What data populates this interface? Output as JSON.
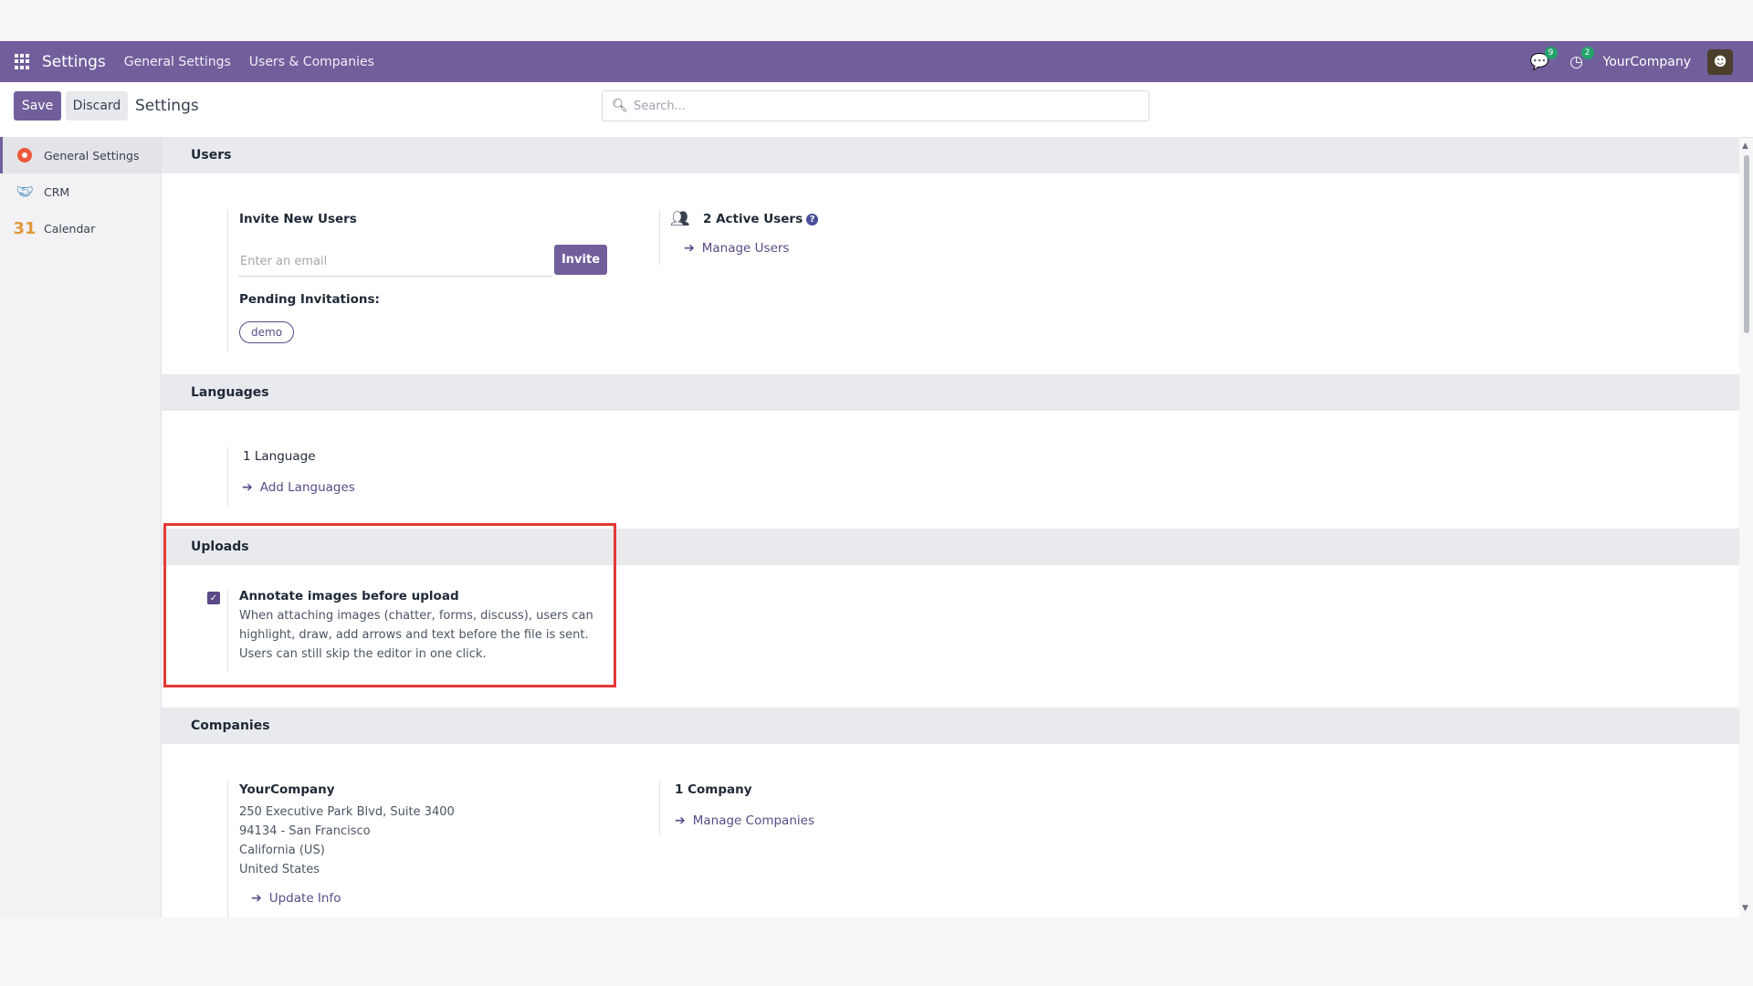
{
  "topbar": {
    "app_name": "Settings",
    "nav": [
      "General Settings",
      "Users & Companies"
    ],
    "messages_count": "9",
    "activities_count": "2",
    "company": "YourCompany"
  },
  "controlbar": {
    "save_label": "Save",
    "discard_label": "Discard",
    "title": "Settings",
    "search_placeholder": "Search..."
  },
  "sidebar": {
    "items": [
      {
        "label": "General Settings",
        "icon": "general-settings-icon"
      },
      {
        "label": "CRM",
        "icon": "crm-icon"
      },
      {
        "label": "Calendar",
        "icon": "calendar-icon",
        "icon_text": "31"
      }
    ]
  },
  "users": {
    "heading": "Users",
    "invite_label": "Invite New Users",
    "email_placeholder": "Enter an email",
    "invite_button": "Invite",
    "pending_label": "Pending Invitations:",
    "pending": [
      "demo"
    ],
    "active_users": "2 Active Users",
    "help_icon": "?",
    "manage_users": "Manage Users"
  },
  "languages": {
    "heading": "Languages",
    "count": "1 Language",
    "add": "Add Languages"
  },
  "uploads": {
    "heading": "Uploads",
    "annotate_checked": true,
    "annotate_label": "Annotate images before upload",
    "annotate_desc": [
      "When attaching images (chatter, forms, discuss), users can",
      "highlight, draw, add arrows and text before the file is sent.",
      "Users can still skip the editor in one click."
    ]
  },
  "companies": {
    "heading": "Companies",
    "name": "YourCompany",
    "address": [
      "250 Executive Park Blvd, Suite 3400",
      "94134 - San Francisco",
      "California (US)",
      "United States"
    ],
    "update": "Update Info",
    "count": "1 Company",
    "manage": "Manage Companies"
  },
  "colors": {
    "brand": "#715f9c",
    "highlight": "#e53935",
    "badge": "#22a36a"
  }
}
